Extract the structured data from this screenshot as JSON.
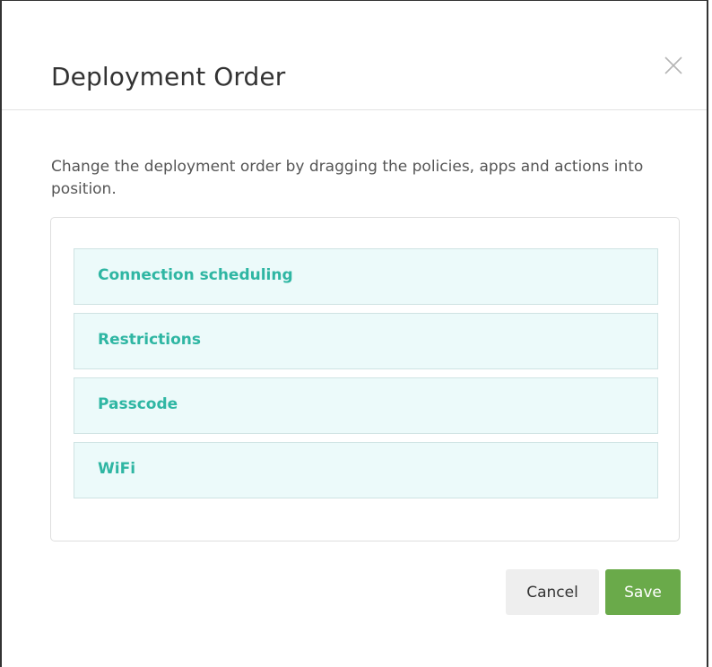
{
  "dialog": {
    "title": "Deployment Order",
    "close_icon": "close-icon",
    "description": "Change the deployment order by dragging the policies, apps and actions into position.",
    "items": [
      {
        "label": "Connection scheduling"
      },
      {
        "label": "Restrictions"
      },
      {
        "label": "Passcode"
      },
      {
        "label": "WiFi"
      }
    ],
    "cancel_label": "Cancel",
    "save_label": "Save"
  },
  "colors": {
    "item_text": "#2fb6a3",
    "item_background": "#ecfafa",
    "save_button": "#6aaa4a",
    "cancel_button": "#eeeeee"
  }
}
